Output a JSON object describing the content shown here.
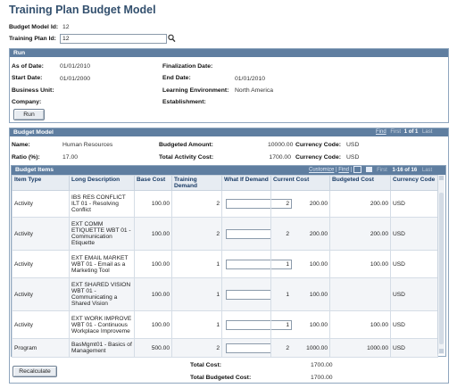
{
  "page": {
    "title": "Training Plan Budget Model"
  },
  "header": {
    "budget_model_id_label": "Budget Model Id:",
    "budget_model_id_value": "12",
    "training_plan_id_label": "Training Plan Id:",
    "training_plan_id_value": "12"
  },
  "run": {
    "title": "Run",
    "as_of_date_label": "As of Date:",
    "as_of_date_value": "01/01/2010",
    "start_date_label": "Start Date:",
    "start_date_value": "01/01/2000",
    "business_unit_label": "Business Unit:",
    "company_label": "Company:",
    "finalization_date_label": "Finalization Date:",
    "end_date_label": "End Date:",
    "end_date_value": "01/01/2010",
    "learning_env_label": "Learning Environment:",
    "learning_env_value": "North America",
    "establishment_label": "Establishment:",
    "run_button": "Run"
  },
  "budget_model": {
    "title": "Budget Model",
    "nav_find": "Find",
    "nav_first": "First",
    "nav_pos": "1 of 1",
    "nav_last": "Last",
    "name_label": "Name:",
    "name_value": "Human Resources",
    "ratio_label": "Ratio (%):",
    "ratio_value": "17.00",
    "budgeted_amount_label": "Budgeted Amount:",
    "budgeted_amount_value": "10000.00",
    "total_activity_cost_label": "Total Activity Cost:",
    "total_activity_cost_value": "1700.00",
    "currency_code_label": "Currency Code:",
    "currency_code_value1": "USD",
    "currency_code_value2": "USD"
  },
  "budget_items": {
    "title": "Budget Items",
    "customize": "Customize",
    "find": "Find",
    "first": "First",
    "range": "1-16 of 16",
    "last": "Last",
    "columns": [
      "Item Type",
      "Long Description",
      "Base Cost",
      "Training Demand",
      "What If Demand",
      "Current Cost",
      "Budgeted Cost",
      "Currency Code"
    ],
    "rows": [
      {
        "type": "Activity",
        "desc": "IBS RES CONFLICT ILT 01 - Resolving Conflict",
        "base": "100.00",
        "demand": "2",
        "whatif": "2",
        "current": "200.00",
        "budgeted": "200.00",
        "currency": "USD"
      },
      {
        "type": "Activity",
        "desc": "EXT COMM ETIQUETTE WBT 01 - Communication Etiquette",
        "base": "100.00",
        "demand": "2",
        "whatif": "2",
        "current": "200.00",
        "budgeted": "200.00",
        "currency": "USD"
      },
      {
        "type": "Activity",
        "desc": "EXT EMAIL MARKET WBT 01 - Email as a Marketing Tool",
        "base": "100.00",
        "demand": "1",
        "whatif": "1",
        "current": "100.00",
        "budgeted": "100.00",
        "currency": "USD"
      },
      {
        "type": "Activity",
        "desc": "EXT SHARED VISION WBT 01 - Communicating a Shared Vision",
        "base": "100.00",
        "demand": "1",
        "whatif": "1",
        "current": "100.00",
        "budgeted": "",
        "currency": "USD"
      },
      {
        "type": "Activity",
        "desc": "EXT WORK IMPROVE WBT 01 - Continuous Workplace Improveme",
        "base": "100.00",
        "demand": "1",
        "whatif": "1",
        "current": "100.00",
        "budgeted": "100.00",
        "currency": "USD"
      },
      {
        "type": "Program",
        "desc": "BasMgmt01 - Basics of Management",
        "base": "500.00",
        "demand": "2",
        "whatif": "2",
        "current": "1000.00",
        "budgeted": "1000.00",
        "currency": "USD"
      }
    ]
  },
  "footer": {
    "recalculate": "Recalculate",
    "total_cost_label": "Total Cost:",
    "total_cost_value": "1700.00",
    "total_budgeted_label": "Total Budgeted Cost:",
    "total_budgeted_value": "1700.00"
  }
}
